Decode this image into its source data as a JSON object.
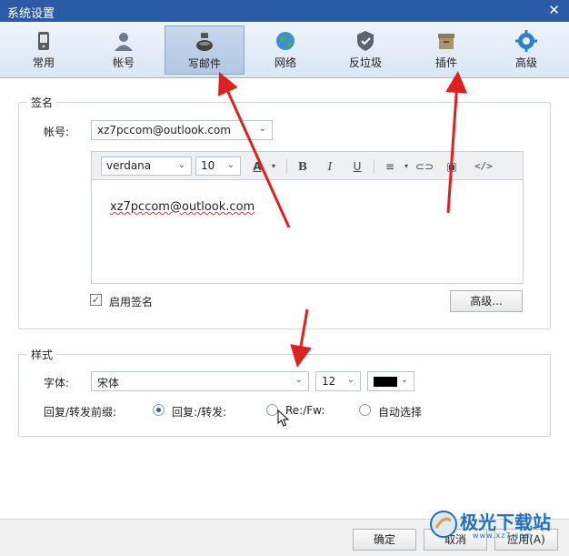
{
  "window": {
    "title": "系统设置",
    "close_glyph": "✕"
  },
  "toolbar": {
    "items": [
      {
        "label": "常用",
        "icon": "phone-icon"
      },
      {
        "label": "帐号",
        "icon": "user-icon"
      },
      {
        "label": "写邮件",
        "icon": "ink-bottle-icon",
        "active": true
      },
      {
        "label": "网络",
        "icon": "globe-icon"
      },
      {
        "label": "反垃圾",
        "icon": "shield-icon"
      },
      {
        "label": "插件",
        "icon": "box-icon"
      },
      {
        "label": "高级",
        "icon": "gear-icon"
      }
    ]
  },
  "signature": {
    "legend": "签名",
    "account_label": "帐号:",
    "account_value": "xz7pccom@outlook.com",
    "font_family": "verdana",
    "font_size": "10",
    "editor_text": "xz7pccom@outlook.com",
    "enable_label": "启用签名",
    "enable_checked": true,
    "advanced_button": "高级..."
  },
  "editor_toolbar": {
    "bold": "B",
    "italic": "I",
    "underline": "U",
    "code": "</>"
  },
  "style": {
    "legend": "样式",
    "font_label": "字体:",
    "font_value": "宋体",
    "size_value": "12",
    "prefix_label": "回复/转发前缀:",
    "options": [
      {
        "label": "回复:/转发:",
        "selected": true
      },
      {
        "label": "Re:/Fw:",
        "selected": false
      },
      {
        "label": "自动选择",
        "selected": false
      }
    ]
  },
  "buttons": {
    "ok": "确定",
    "cancel": "取消",
    "apply": "应用(A)"
  },
  "watermark": {
    "text": "极光下载站",
    "sub": "www.xz7.com"
  },
  "colors": {
    "title_bar": "#2b5aa6",
    "arrow": "#e02020",
    "swatch": "#000000"
  }
}
